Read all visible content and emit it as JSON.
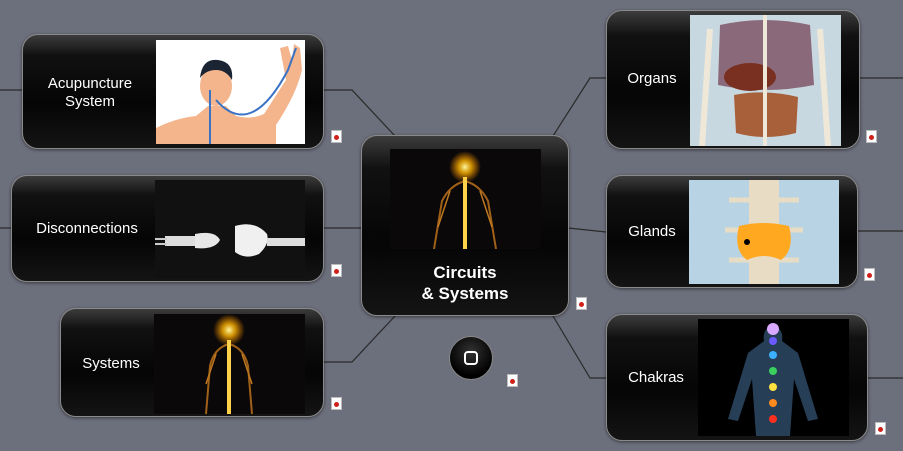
{
  "central": {
    "title_line1": "Circuits",
    "title_line2": "& Systems"
  },
  "nodes": {
    "acupuncture": {
      "label_line1": "Acupuncture",
      "label_line2": "System"
    },
    "disconnections": {
      "label": "Disconnections"
    },
    "systems": {
      "label": "Systems"
    },
    "organs": {
      "label": "Organs"
    },
    "glands": {
      "label": "Glands"
    },
    "chakras": {
      "label": "Chakras"
    }
  },
  "icons": {
    "attachment": "pdf-attachment-icon",
    "button": "rounded-square-icon"
  },
  "colors": {
    "background": "#6c6f7c",
    "node_fill": "#050505",
    "connector": "#2a2a2a",
    "glow": "#ffcc33"
  }
}
